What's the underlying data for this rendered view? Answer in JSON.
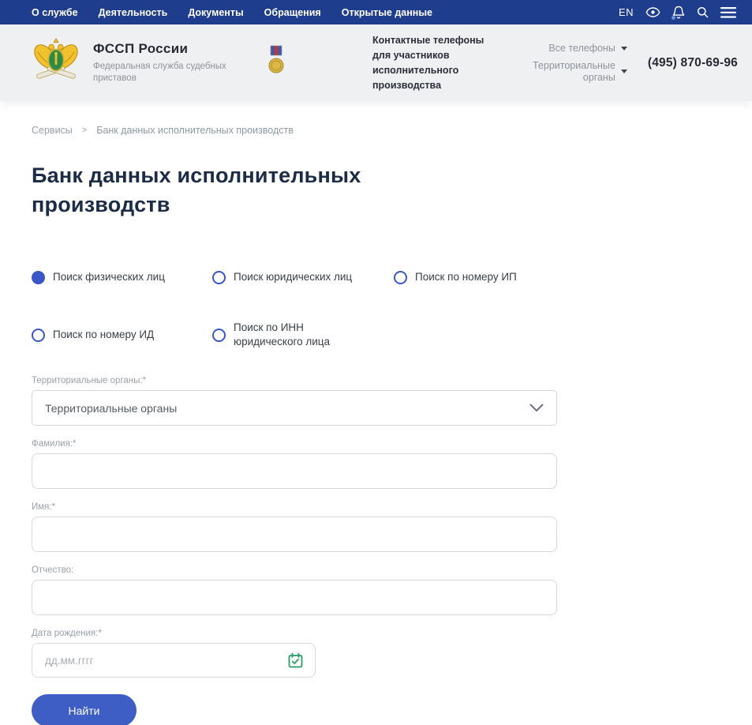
{
  "nav": {
    "items": [
      "О службе",
      "Деятельность",
      "Документы",
      "Обращения",
      "Открытые данные"
    ],
    "lang": "EN",
    "icons": [
      "eye-icon",
      "bell-icon",
      "search-icon",
      "menu-icon"
    ]
  },
  "header": {
    "org_name": "ФССП России",
    "org_subtitle": "Федеральная служба судебных приставов",
    "contact_title": "Контактные телефоны для участников исполнительного производства",
    "all_phones_label": "Все телефоны",
    "territorial_label": "Территориальные органы",
    "phone": "(495) 870-69-96",
    "icons": [
      "fssp-emblem",
      "medal-icon"
    ]
  },
  "breadcrumb": {
    "items": [
      "Сервисы",
      "Банк данных исполнительных производств"
    ]
  },
  "page": {
    "title": "Банк данных исполнительных производств"
  },
  "search_types": [
    {
      "label": "Поиск физических лиц",
      "selected": true
    },
    {
      "label": "Поиск юридических лиц",
      "selected": false
    },
    {
      "label": "Поиск по номеру ИП",
      "selected": false
    },
    {
      "label": "Поиск по номеру ИД",
      "selected": false
    },
    {
      "label": "Поиск по ИНН юридического лица",
      "selected": false
    }
  ],
  "form": {
    "territorial_label": "Территориальные органы:*",
    "territorial_value": "Территориальные органы",
    "lastname_label": "Фамилия:*",
    "lastname_value": "",
    "firstname_label": "Имя:*",
    "firstname_value": "",
    "patronymic_label": "Отчество:",
    "patronymic_value": "",
    "birthdate_label": "Дата рождения:*",
    "birthdate_placeholder": "дд.мм.гггг",
    "birthdate_value": "",
    "calendar_icon": "calendar-check-icon",
    "submit_label": "Найти"
  },
  "colors": {
    "nav_blue": "#1f3d8d",
    "header_bg": "#eef0f2",
    "accent_blue": "#3a57c8",
    "button_blue": "#3e5ec5",
    "title_dark": "#1c2b46",
    "calendar_green": "#259d63"
  }
}
